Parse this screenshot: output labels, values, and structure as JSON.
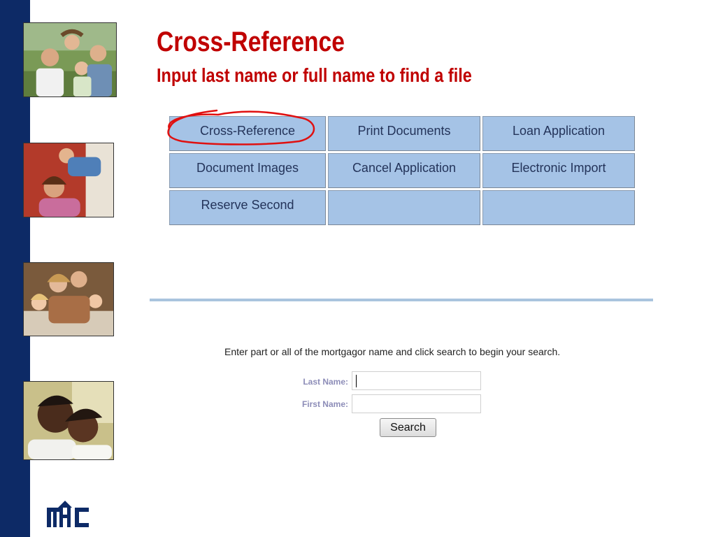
{
  "header": {
    "title": "Cross-Reference",
    "subtitle": "Input last name or full name to find a file"
  },
  "menu": {
    "items": [
      {
        "label": "Cross-Reference"
      },
      {
        "label": "Print Documents"
      },
      {
        "label": "Loan Application"
      },
      {
        "label": "Document Images"
      },
      {
        "label": "Cancel Application"
      },
      {
        "label": "Electronic Import"
      },
      {
        "label": "Reserve Second"
      },
      {
        "label": ""
      },
      {
        "label": ""
      }
    ],
    "highlighted_item": "Cross-Reference"
  },
  "search": {
    "instructions": "Enter part or all of the mortgagor name and click search to begin your search.",
    "last_name_label": "Last Name:",
    "first_name_label": "First Name:",
    "last_name_value": "",
    "first_name_value": "",
    "button_label": "Search"
  },
  "sidebar": {
    "photos": [
      "family-photo-icon",
      "parent-child-photo-icon",
      "family-couch-photo-icon",
      "couple-photo-icon"
    ],
    "logo": "mhc-logo-icon"
  },
  "colors": {
    "sidebar": "#0d2a66",
    "title": "#c00000",
    "menu_cell": "#a5c3e6",
    "divider": "#a9c4de",
    "highlight": "#e01010"
  }
}
